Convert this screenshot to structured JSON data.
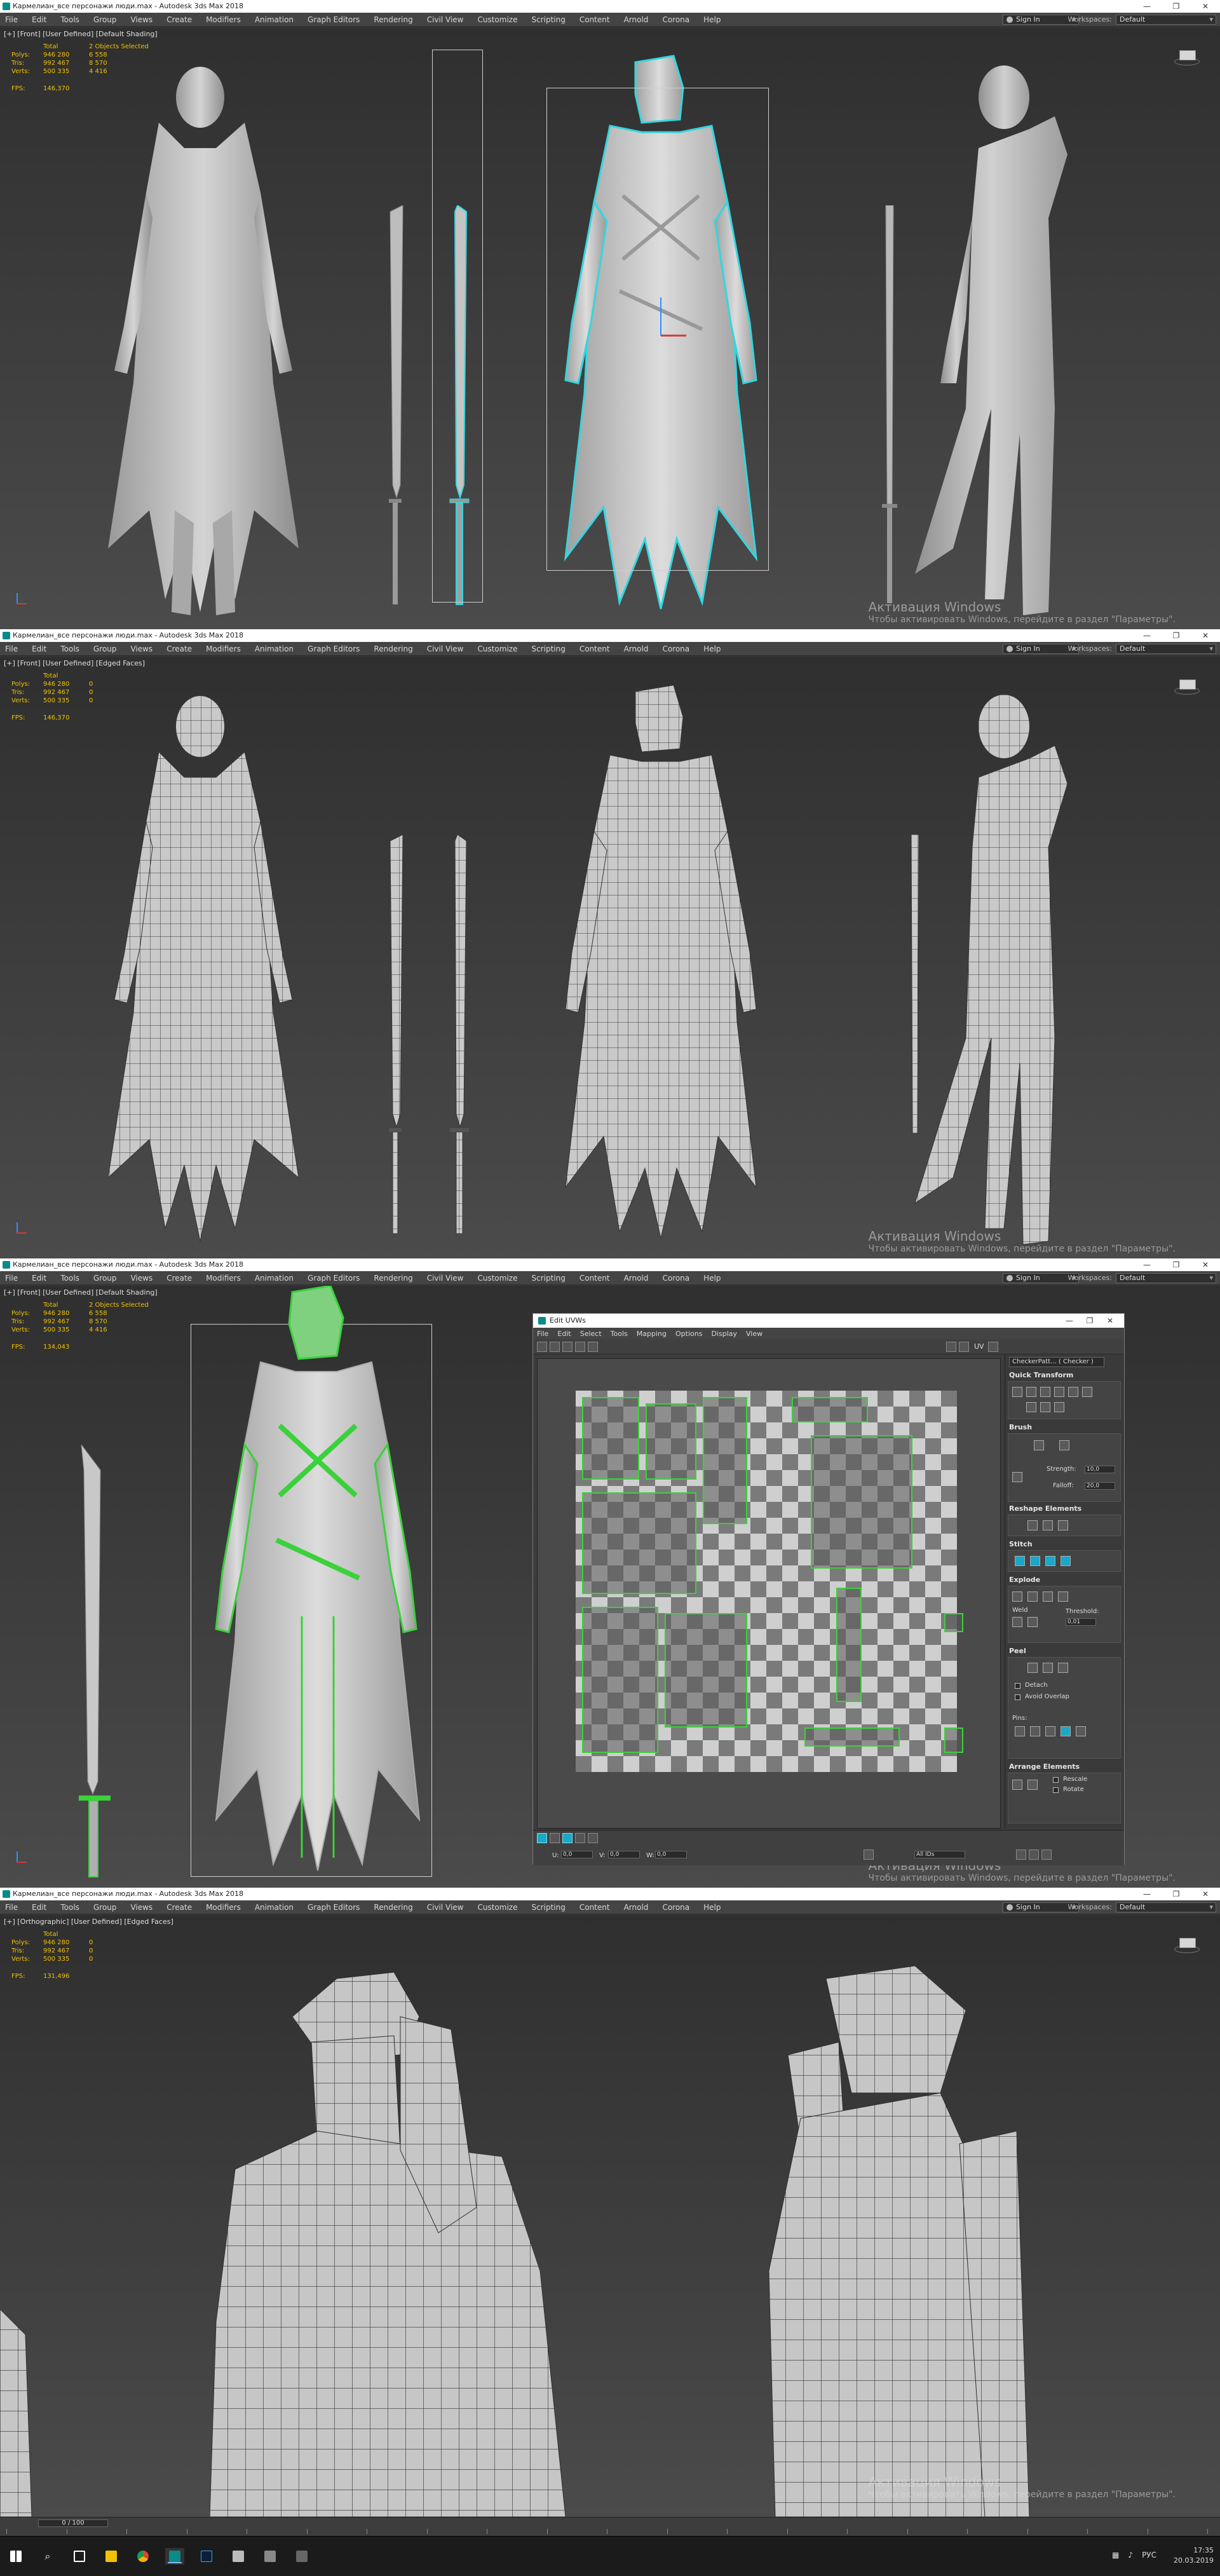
{
  "app": {
    "window_title": "Кармелиан_все персонажи люди.max - Autodesk 3ds Max 2018",
    "menu": [
      "File",
      "Edit",
      "Tools",
      "Group",
      "Views",
      "Create",
      "Modifiers",
      "Animation",
      "Graph Editors",
      "Rendering",
      "Civil View",
      "Customize",
      "Scripting",
      "Content",
      "Arnold",
      "Corona",
      "Help"
    ],
    "sign_in": "Sign In",
    "workspaces_label": "Workspaces:",
    "workspaces_value": "Default",
    "window_controls": [
      "—",
      "❐",
      "✕"
    ]
  },
  "panels": [
    {
      "viewport_label": "[+] [Front] [User Defined] [Default Shading]",
      "stats": {
        "header": "Total",
        "selected": "2 Objects Selected",
        "polys_label": "Polys:",
        "polys_total": "946 280",
        "polys_sel": "6 558",
        "tris_label": "Tris:",
        "tris_total": "992 467",
        "tris_sel": "8 570",
        "verts_label": "Verts:",
        "verts_total": "500 335",
        "verts_sel": "4 416",
        "fps_label": "FPS:",
        "fps": "146,370"
      }
    },
    {
      "viewport_label": "[+] [Front] [User Defined] [Edged Faces]",
      "stats": {
        "header": "Total",
        "selected": "",
        "polys_label": "Polys:",
        "polys_total": "946 280",
        "polys_sel": "0",
        "tris_label": "Tris:",
        "tris_total": "992 467",
        "tris_sel": "0",
        "verts_label": "Verts:",
        "verts_total": "500 335",
        "verts_sel": "0",
        "fps_label": "FPS:",
        "fps": "146,370"
      }
    },
    {
      "viewport_label": "[+] [Front] [User Defined] [Default Shading]",
      "stats": {
        "header": "Total",
        "selected": "2 Objects Selected",
        "polys_label": "Polys:",
        "polys_total": "946 280",
        "polys_sel": "6 558",
        "tris_label": "Tris:",
        "tris_total": "992 467",
        "tris_sel": "8 570",
        "verts_label": "Verts:",
        "verts_total": "500 335",
        "verts_sel": "4 416",
        "fps_label": "FPS:",
        "fps": "134,043"
      }
    },
    {
      "viewport_label": "[+] [Orthographic] [User Defined] [Edged Faces]",
      "stats": {
        "header": "Total",
        "selected": "",
        "polys_label": "Polys:",
        "polys_total": "946 280",
        "polys_sel": "0",
        "tris_label": "Tris:",
        "tris_total": "992 467",
        "tris_sel": "0",
        "verts_label": "Verts:",
        "verts_total": "500 335",
        "verts_sel": "0",
        "fps_label": "FPS:",
        "fps": "131,496"
      }
    }
  ],
  "watermark": {
    "line1": "Активация Windows",
    "line2": "Чтобы активировать Windows, перейдите в раздел \"Параметры\"."
  },
  "uv_editor": {
    "title": "Edit UVWs",
    "menu": [
      "File",
      "Edit",
      "Select",
      "Tools",
      "Mapping",
      "Options",
      "Display",
      "View"
    ],
    "texture_select": "CheckerPatt... ( Checker )",
    "uv_label": "UV",
    "sections": {
      "quick_transform": "Quick Transform",
      "brush": "Brush",
      "reshape": "Reshape Elements",
      "stitch": "Stitch",
      "explode": "Explode",
      "peel": "Peel",
      "arrange": "Arrange Elements"
    },
    "strength_label": "Strength:",
    "strength_value": "10,0",
    "falloff_label": "Falloff:",
    "falloff_value": "20,0",
    "weld_label": "Weld",
    "threshold_label": "Threshold:",
    "threshold_value": "0,01",
    "detach_label": "Detach",
    "avoid_overlap_label": "Avoid Overlap",
    "pins_label": "Pins:",
    "rescale_label": "Rescale",
    "rotate_label": "Rotate",
    "bottom_u_label": "U:",
    "bottom_v_label": "V:",
    "bottom_w_label": "W:",
    "bottom_value": "0,0",
    "all_ids": "All IDs"
  },
  "timeline": {
    "frame_display": "0 / 100",
    "ticks": [
      "0",
      "5",
      "10",
      "15",
      "20",
      "25",
      "30",
      "35",
      "40",
      "45",
      "50",
      "55",
      "60",
      "65",
      "70",
      "75",
      "80",
      "85",
      "90",
      "95",
      "100"
    ]
  },
  "taskbar": {
    "time": "17:35",
    "date": "20.03.2019",
    "lang": "РУС",
    "apps": [
      "windows-start",
      "search",
      "task-view",
      "explorer",
      "chrome",
      "3dsmax",
      "photoshop",
      "other1",
      "other2",
      "other3"
    ]
  },
  "colors": {
    "selection_cyan": "#33d6e0",
    "selection_green": "#3bd13b",
    "stats_yellow": "#f2c200"
  }
}
